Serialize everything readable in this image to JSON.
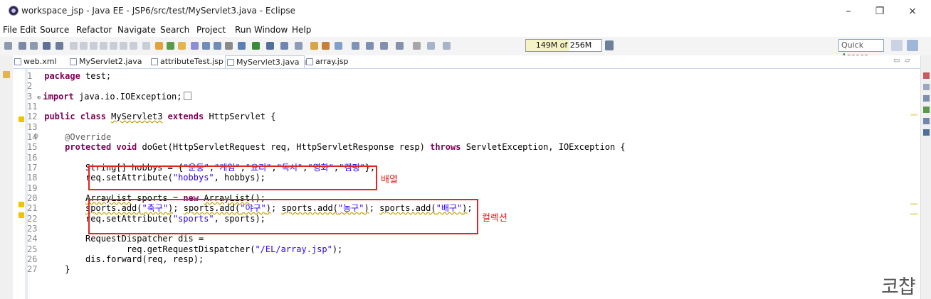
{
  "window": {
    "title": "workspace_jsp - Java EE - JSP6/src/test/MyServlet3.java - Eclipse",
    "minimize": "–",
    "maximize": "❐",
    "close": "×"
  },
  "menu": [
    "File",
    "Edit",
    "Source",
    "Refactor",
    "Navigate",
    "Search",
    "Project",
    "Run",
    "Window",
    "Help"
  ],
  "toolbar": {
    "heap_status": "149M of 256M",
    "heap_used_fraction": 0.58,
    "quick_access_placeholder": "Quick Access"
  },
  "tabs": [
    {
      "label": "web.xml",
      "active": false
    },
    {
      "label": "MyServlet2.java",
      "active": false
    },
    {
      "label": "attributeTest.jsp",
      "active": false
    },
    {
      "label": "MyServlet3.java",
      "active": true,
      "close": "⊠"
    },
    {
      "label": "array.jsp",
      "active": false
    }
  ],
  "code": [
    {
      "num": "1",
      "text": "package test;"
    },
    {
      "num": "2",
      "text": ""
    },
    {
      "num": "3",
      "text": "import java.io.IOException;"
    },
    {
      "num": "11",
      "text": ""
    },
    {
      "num": "12",
      "text": "public class MyServlet3 extends HttpServlet {"
    },
    {
      "num": "13",
      "text": ""
    },
    {
      "num": "14",
      "text": "    @Override"
    },
    {
      "num": "15",
      "text": "    protected void doGet(HttpServletRequest req, HttpServletResponse resp) throws ServletException, IOException {"
    },
    {
      "num": "16",
      "text": ""
    },
    {
      "num": "17",
      "text": "        String[] hobbys = {\"운동\",\"게임\",\"요리\",\"독서\",\"영화\",\"캠핑\"};"
    },
    {
      "num": "18",
      "text": "        req.setAttribute(\"hobbys\", hobbys);"
    },
    {
      "num": "19",
      "text": ""
    },
    {
      "num": "20",
      "text": "        ArrayList sports = new ArrayList();"
    },
    {
      "num": "21",
      "text": "        sports.add(\"축구\"); sports.add(\"야구\"); sports.add(\"농구\"); sports.add(\"배구\");"
    },
    {
      "num": "22",
      "text": "        req.setAttribute(\"sports\", sports);"
    },
    {
      "num": "23",
      "text": ""
    },
    {
      "num": "24",
      "text": "        RequestDispatcher dis ="
    },
    {
      "num": "25",
      "text": "                req.getRequestDispatcher(\"/EL/array.jsp\");"
    },
    {
      "num": "26",
      "text": "        dis.forward(req, resp);"
    },
    {
      "num": "27",
      "text": "    }"
    }
  ],
  "annotations": {
    "array_label": "배열",
    "collection_label": "컬렉션"
  },
  "watermark": "코챱",
  "colors": {
    "keyword": "#7f0055",
    "string": "#2a00ff",
    "annotation": "#646464",
    "highlight_box": "#e52323"
  }
}
